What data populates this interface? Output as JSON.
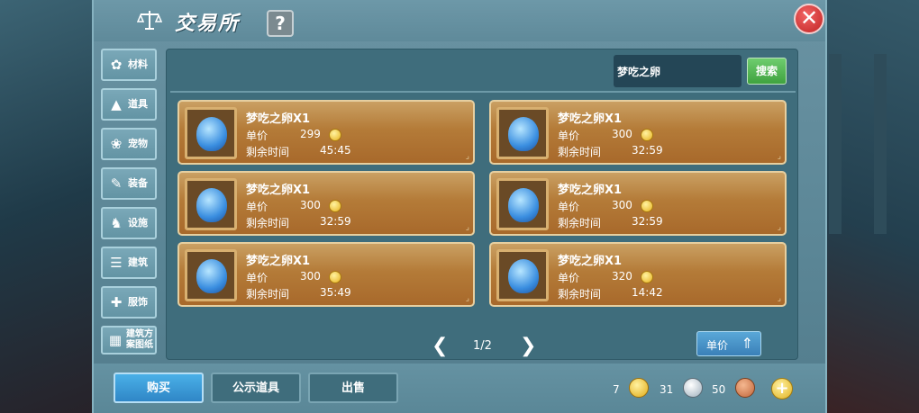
{
  "header": {
    "title": "交易所",
    "help_label": "?",
    "close_label": "✕"
  },
  "categories": [
    {
      "label": "材料",
      "icon": "materials-icon",
      "glyph": "✿"
    },
    {
      "label": "道具",
      "icon": "props-icon",
      "glyph": "▲"
    },
    {
      "label": "宠物",
      "icon": "pet-paw-icon",
      "glyph": "❀"
    },
    {
      "label": "装备",
      "icon": "equipment-icon",
      "glyph": "✎"
    },
    {
      "label": "设施",
      "icon": "facility-icon",
      "glyph": "♞"
    },
    {
      "label": "建筑",
      "icon": "building-icon",
      "glyph": "☰"
    },
    {
      "label": "服饰",
      "icon": "clothing-icon",
      "glyph": "✚"
    },
    {
      "label": "建筑方案图纸",
      "icon": "blueprint-icon",
      "glyph": "▦"
    }
  ],
  "search": {
    "value": "梦吃之卵",
    "button_label": "搜索"
  },
  "listings": [
    {
      "name": "梦吃之卵X1",
      "price_label": "单价",
      "price": "299",
      "time_label": "剩余时间",
      "time": "45:45"
    },
    {
      "name": "梦吃之卵X1",
      "price_label": "单价",
      "price": "300",
      "time_label": "剩余时间",
      "time": "32:59"
    },
    {
      "name": "梦吃之卵X1",
      "price_label": "单价",
      "price": "300",
      "time_label": "剩余时间",
      "time": "32:59"
    },
    {
      "name": "梦吃之卵X1",
      "price_label": "单价",
      "price": "300",
      "time_label": "剩余时间",
      "time": "32:59"
    },
    {
      "name": "梦吃之卵X1",
      "price_label": "单价",
      "price": "300",
      "time_label": "剩余时间",
      "time": "35:49"
    },
    {
      "name": "梦吃之卵X1",
      "price_label": "单价",
      "price": "320",
      "time_label": "剩余时间",
      "time": "14:42"
    }
  ],
  "pager": {
    "prev": "❮",
    "next": "❯",
    "text": "1/2"
  },
  "sort": {
    "label": "单价",
    "arrow": "⇑"
  },
  "tabs": {
    "buy": "购买",
    "show": "公示道具",
    "sell": "出售"
  },
  "currency": {
    "gold": "7",
    "silver": "31",
    "copper": "50",
    "add": "+"
  }
}
